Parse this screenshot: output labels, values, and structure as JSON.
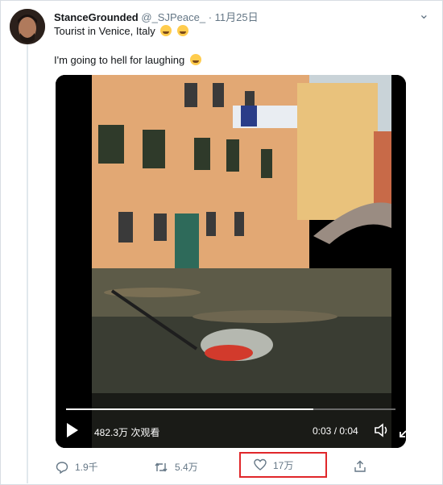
{
  "tweet": {
    "display_name": "StanceGrounded",
    "handle": "@_SJPeace_",
    "separator": "·",
    "date": "11月25日",
    "line1": "Tourist in Venice, Italy",
    "line2": "I'm going to hell for laughing"
  },
  "video": {
    "views": "482.3万 次观看",
    "time": "0:03 / 0:04",
    "progress": 0.75
  },
  "actions": {
    "replies": "1.9千",
    "retweets": "5.4万",
    "likes": "17万"
  },
  "colors": {
    "highlight": "#e0272a",
    "meta": "#657786"
  }
}
